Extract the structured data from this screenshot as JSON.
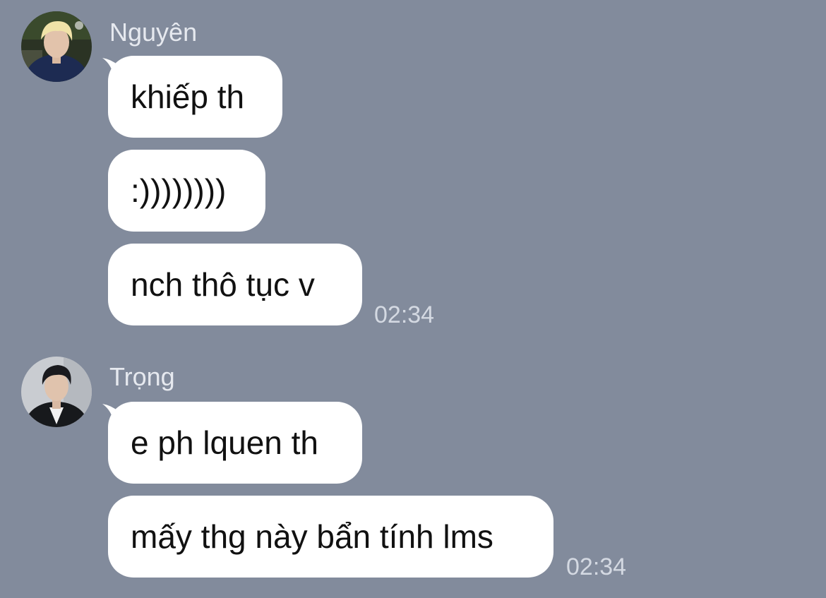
{
  "colors": {
    "background": "#828b9c",
    "bubble": "#ffffff",
    "message_text": "#111111",
    "sender_name": "#e6e9ef",
    "timestamp": "#d4d9e2"
  },
  "groups": [
    {
      "sender": "Nguyên",
      "avatar_icon": "avatar-blond-person-icon",
      "messages": [
        {
          "text": "khiếp th"
        },
        {
          "text": ":))))))))"
        },
        {
          "text": "nch thô tục v"
        }
      ],
      "time": "02:34"
    },
    {
      "sender": "Trọng",
      "avatar_icon": "avatar-dark-haired-person-icon",
      "messages": [
        {
          "text": "e ph lquen th"
        },
        {
          "text": "mấy thg này bẩn tính lms"
        }
      ],
      "time": "02:34"
    }
  ]
}
